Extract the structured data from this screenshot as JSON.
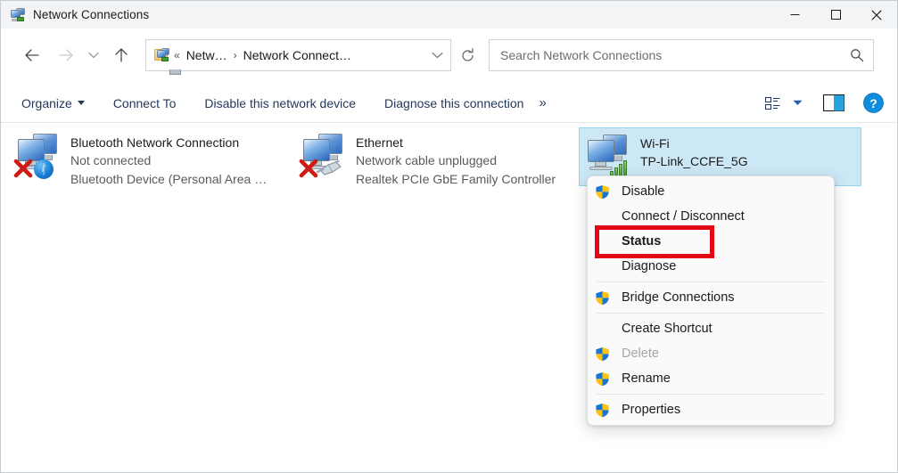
{
  "window": {
    "title": "Network Connections",
    "icon": "network-connections-icon",
    "controls": {
      "minimize": "minimize-button",
      "maximize": "maximize-button",
      "close": "close-button"
    }
  },
  "navbar": {
    "back": "back-arrow-icon",
    "forward": "forward-arrow-icon",
    "recent": "recent-locations-chevron-icon",
    "up": "up-arrow-icon",
    "refresh": "refresh-icon",
    "address": {
      "icon": "control-panel-icon",
      "leading_chevrons": "«",
      "crumbs": [
        "Netw…",
        "Network Connect…"
      ],
      "separator": "›",
      "dropdown": "chevron-down-icon"
    },
    "search": {
      "placeholder": "Search Network Connections",
      "value": "",
      "icon": "search-icon"
    }
  },
  "commandbar": {
    "items": [
      {
        "label": "Organize",
        "has_caret": true
      },
      {
        "label": "Connect To",
        "has_caret": false
      },
      {
        "label": "Disable this network device",
        "has_caret": false
      },
      {
        "label": "Diagnose this connection",
        "has_caret": false
      }
    ],
    "overflow": "»",
    "right_icons": [
      "view-options-icon",
      "view-options-chevron-icon",
      "preview-pane-icon",
      "help-icon"
    ],
    "help_glyph": "?"
  },
  "connections": [
    {
      "name": "Bluetooth Network Connection",
      "status": "Not connected",
      "device": "Bluetooth Device (Personal Area …",
      "selected": false,
      "badge": "bluetooth",
      "disconnected": true
    },
    {
      "name": "Ethernet",
      "status": "Network cable unplugged",
      "device": "Realtek PCIe GbE Family Controller",
      "selected": false,
      "badge": "rj45",
      "disconnected": true
    },
    {
      "name": "Wi-Fi",
      "status": "TP-Link_CCFE_5G",
      "device": "",
      "selected": true,
      "badge": "wifi",
      "disconnected": false
    }
  ],
  "context_menu": {
    "items": [
      {
        "label": "Disable",
        "shield": true,
        "bold": false,
        "disabled": false,
        "sep_after": false
      },
      {
        "label": "Connect / Disconnect",
        "shield": false,
        "bold": false,
        "disabled": false,
        "sep_after": false
      },
      {
        "label": "Status",
        "shield": false,
        "bold": true,
        "disabled": false,
        "sep_after": false
      },
      {
        "label": "Diagnose",
        "shield": false,
        "bold": false,
        "disabled": false,
        "sep_after": true
      },
      {
        "label": "Bridge Connections",
        "shield": true,
        "bold": false,
        "disabled": false,
        "sep_after": true
      },
      {
        "label": "Create Shortcut",
        "shield": false,
        "bold": false,
        "disabled": false,
        "sep_after": false
      },
      {
        "label": "Delete",
        "shield": true,
        "bold": false,
        "disabled": true,
        "sep_after": false
      },
      {
        "label": "Rename",
        "shield": true,
        "bold": false,
        "disabled": false,
        "sep_after": true
      },
      {
        "label": "Properties",
        "shield": true,
        "bold": false,
        "disabled": false,
        "sep_after": false
      }
    ]
  },
  "annotation": {
    "target": "Status",
    "color": "#e30613",
    "shape": "rectangle"
  },
  "colors": {
    "selection": "#cce8f7",
    "selection_border": "#99d1ef",
    "titlebar": "#f3f4f6",
    "command_text": "#23395b",
    "annotation_red": "#e30613",
    "help_blue": "#0a84d8"
  }
}
